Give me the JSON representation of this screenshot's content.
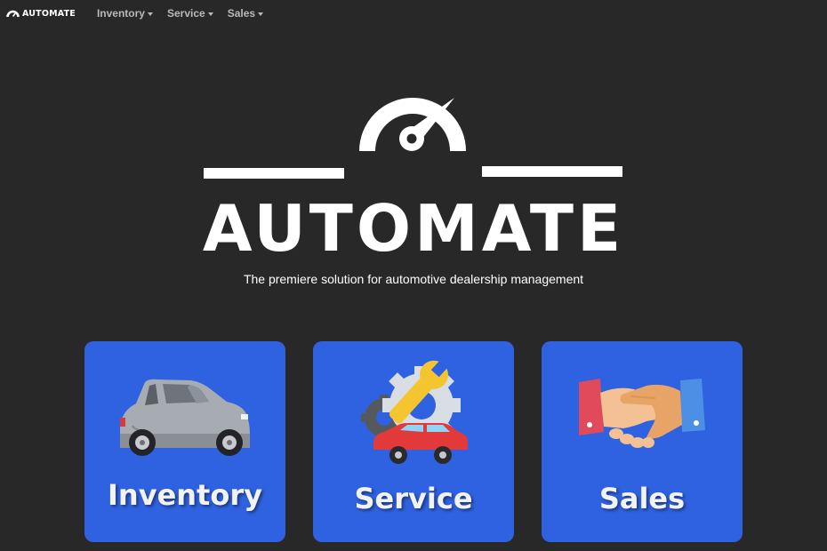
{
  "navbar": {
    "brand": "AUTOMATE",
    "items": [
      {
        "label": "Inventory"
      },
      {
        "label": "Service"
      },
      {
        "label": "Sales"
      }
    ]
  },
  "hero": {
    "title": "AUTOMATE",
    "tagline": "The premiere solution for automotive dealership management"
  },
  "cards": [
    {
      "label": "Inventory",
      "icon": "car-icon"
    },
    {
      "label": "Service",
      "icon": "wrench-gear-car-icon"
    },
    {
      "label": "Sales",
      "icon": "handshake-icon"
    }
  ],
  "colors": {
    "background": "#282828",
    "card": "#2f62e0",
    "nav_text": "#b9b9b9",
    "text": "#ffffff"
  }
}
